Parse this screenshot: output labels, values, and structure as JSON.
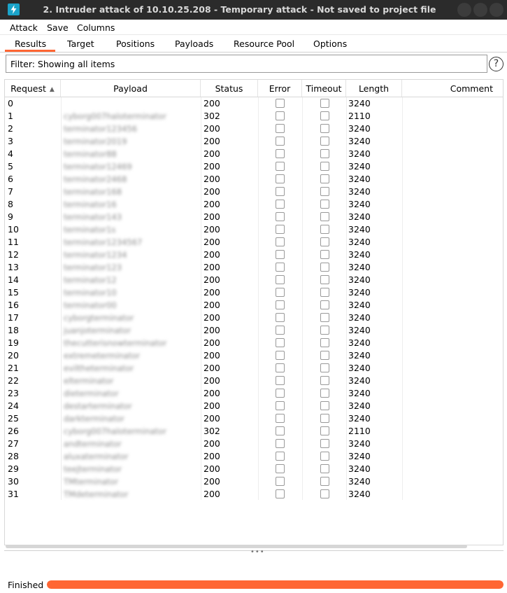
{
  "window": {
    "title": "2. Intruder attack of 10.10.25.208 - Temporary attack - Not saved to project file"
  },
  "menu": [
    "Attack",
    "Save",
    "Columns"
  ],
  "tabs": [
    "Results",
    "Target",
    "Positions",
    "Payloads",
    "Resource Pool",
    "Options"
  ],
  "active_tab": "Results",
  "filter": {
    "text": "Filter: Showing all items"
  },
  "help_icon": "?",
  "table": {
    "columns": [
      "Request",
      "Payload",
      "Status",
      "Error",
      "Timeout",
      "Length",
      "Comment"
    ],
    "sort_column": "Request",
    "sort_direction": "ascending",
    "rows": [
      {
        "request": "0",
        "payload": "",
        "status": "200",
        "length": "3240"
      },
      {
        "request": "1",
        "payload": "cyborg007haloterminator",
        "status": "302",
        "length": "2110"
      },
      {
        "request": "2",
        "payload": "terminator123456",
        "status": "200",
        "length": "3240"
      },
      {
        "request": "3",
        "payload": "terminator2019",
        "status": "200",
        "length": "3240"
      },
      {
        "request": "4",
        "payload": "terminator88",
        "status": "200",
        "length": "3240"
      },
      {
        "request": "5",
        "payload": "terminator12469",
        "status": "200",
        "length": "3240"
      },
      {
        "request": "6",
        "payload": "terminator2468",
        "status": "200",
        "length": "3240"
      },
      {
        "request": "7",
        "payload": "terminator168",
        "status": "200",
        "length": "3240"
      },
      {
        "request": "8",
        "payload": "terminator16",
        "status": "200",
        "length": "3240"
      },
      {
        "request": "9",
        "payload": "terminator143",
        "status": "200",
        "length": "3240"
      },
      {
        "request": "10",
        "payload": "terminator1s",
        "status": "200",
        "length": "3240"
      },
      {
        "request": "11",
        "payload": "terminator1234567",
        "status": "200",
        "length": "3240"
      },
      {
        "request": "12",
        "payload": "terminator1234",
        "status": "200",
        "length": "3240"
      },
      {
        "request": "13",
        "payload": "terminator123",
        "status": "200",
        "length": "3240"
      },
      {
        "request": "14",
        "payload": "terminator12",
        "status": "200",
        "length": "3240"
      },
      {
        "request": "15",
        "payload": "terminator10",
        "status": "200",
        "length": "3240"
      },
      {
        "request": "16",
        "payload": "terminator00",
        "status": "200",
        "length": "3240"
      },
      {
        "request": "17",
        "payload": "cyborgterminator",
        "status": "200",
        "length": "3240"
      },
      {
        "request": "18",
        "payload": "juanjoterminator",
        "status": "200",
        "length": "3240"
      },
      {
        "request": "19",
        "payload": "thecutterisnowterminator",
        "status": "200",
        "length": "3240"
      },
      {
        "request": "20",
        "payload": "extremeterminator",
        "status": "200",
        "length": "3240"
      },
      {
        "request": "21",
        "payload": "eviltheterminator",
        "status": "200",
        "length": "3240"
      },
      {
        "request": "22",
        "payload": "elterminator",
        "status": "200",
        "length": "3240"
      },
      {
        "request": "23",
        "payload": "dieterminator",
        "status": "200",
        "length": "3240"
      },
      {
        "request": "24",
        "payload": "destarterminator",
        "status": "200",
        "length": "3240"
      },
      {
        "request": "25",
        "payload": "darkterminator",
        "status": "200",
        "length": "3240"
      },
      {
        "request": "26",
        "payload": "cyborg007haloterminator",
        "status": "302",
        "length": "2110"
      },
      {
        "request": "27",
        "payload": "andterminator",
        "status": "200",
        "length": "3240"
      },
      {
        "request": "28",
        "payload": "aluxaterminator",
        "status": "200",
        "length": "3240"
      },
      {
        "request": "29",
        "payload": "teejterminator",
        "status": "200",
        "length": "3240"
      },
      {
        "request": "30",
        "payload": "TMterminator",
        "status": "200",
        "length": "3240"
      },
      {
        "request": "31",
        "payload": "TMdeterminator",
        "status": "200",
        "length": "3240"
      }
    ]
  },
  "status": {
    "text": "Finished",
    "progress_percent": 100
  },
  "colors": {
    "accent": "#ff6633",
    "titlebar": "#2b2b2b",
    "app_icon": "#1aa3c9"
  }
}
